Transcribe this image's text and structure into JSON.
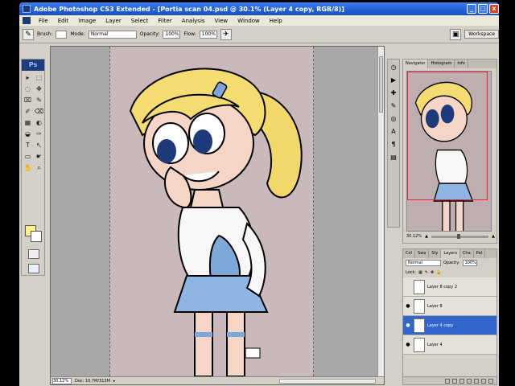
{
  "window": {
    "title": "Adobe Photoshop CS3 Extended - [Portia scan 04.psd @ 30.1% (Layer 4 copy, RGB/8)]",
    "buttons": [
      "_",
      "□",
      "x"
    ]
  },
  "menu": {
    "items": [
      "File",
      "Edit",
      "Image",
      "Layer",
      "Select",
      "Filter",
      "Analysis",
      "View",
      "Window",
      "Help"
    ]
  },
  "options": {
    "brush_label": "Brush:",
    "mode_label": "Mode:",
    "mode_value": "Normal",
    "opacity_label": "Opacity:",
    "opacity_value": "100%",
    "flow_label": "Flow:",
    "flow_value": "100%",
    "workspace_label": "Workspace"
  },
  "toolbox": {
    "badge": "Ps",
    "tools": [
      "▸",
      "⬚",
      "◌",
      "✥",
      "⌧",
      "✎",
      "✐",
      "⌫",
      "▦",
      "◐",
      "◒",
      "✑",
      "T",
      "↖",
      "▭",
      "☛",
      "✋",
      "⌕"
    ],
    "foreground_color": "#fff38a",
    "background_color": "#ffffff"
  },
  "document": {
    "status_zoom": "30.12%",
    "status_doc": "Doc: 10.7M/313M"
  },
  "navigator": {
    "tabs": [
      "Navigator",
      "Histogram",
      "Info"
    ],
    "zoom": "30.12%"
  },
  "layers": {
    "tabs": [
      "Col",
      "Swa",
      "Sty",
      "Layers",
      "Cha",
      "Pat"
    ],
    "blend_mode": "Normal",
    "opacity_label": "Opacity:",
    "opacity_value": "100%",
    "lock_label": "Lock:",
    "items": [
      {
        "name": "Layer 8 copy 2",
        "active": false
      },
      {
        "name": "Layer 8",
        "active": false
      },
      {
        "name": "Layer 4 copy",
        "active": true
      },
      {
        "name": "Layer 4",
        "active": false
      }
    ]
  },
  "colors": {
    "title_blue": "#1f5fd6",
    "selected_layer": "#3266cc",
    "canvas_bg": "#cab9bb"
  }
}
